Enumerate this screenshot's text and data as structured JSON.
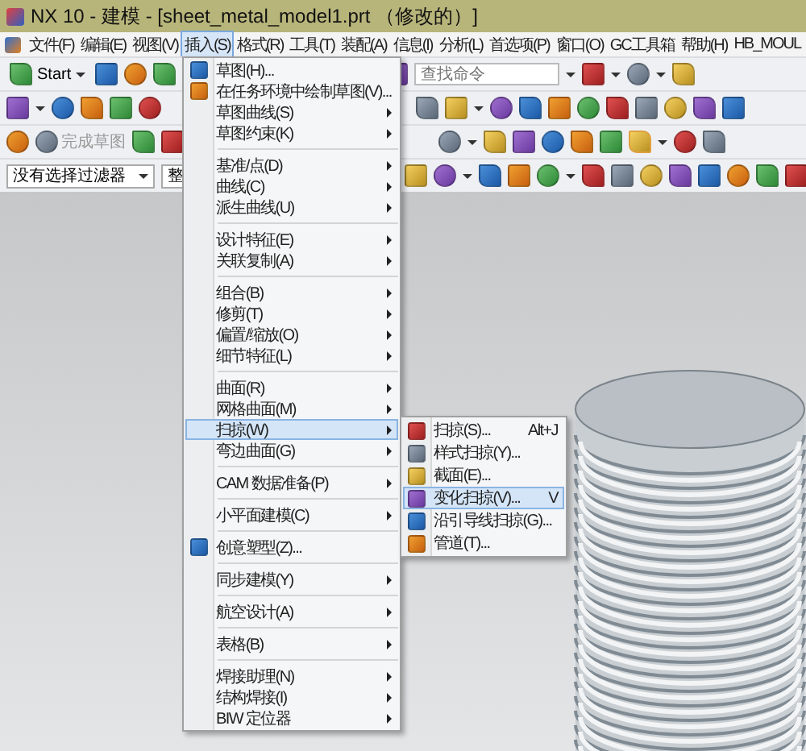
{
  "window": {
    "title": "NX 10 - 建模 - [sheet_metal_model1.prt （修改的）]"
  },
  "menubar": [
    {
      "label": "文件(F)",
      "selected": false
    },
    {
      "label": "编辑(E)",
      "selected": false
    },
    {
      "label": "视图(V)",
      "selected": false
    },
    {
      "label": "插入(S)",
      "selected": true
    },
    {
      "label": "格式(R)",
      "selected": false
    },
    {
      "label": "工具(T)",
      "selected": false
    },
    {
      "label": "装配(A)",
      "selected": false
    },
    {
      "label": "信息(I)",
      "selected": false
    },
    {
      "label": "分析(L)",
      "selected": false
    },
    {
      "label": "首选项(P)",
      "selected": false
    },
    {
      "label": "窗口(O)",
      "selected": false
    },
    {
      "label": "GC工具箱",
      "selected": false
    },
    {
      "label": "帮助(H)",
      "selected": false
    },
    {
      "label": "HB_MOUL",
      "selected": false
    }
  ],
  "toolbar": {
    "start_button": "Start",
    "search": {
      "placeholder": "查找命令"
    },
    "finish_sketch": {
      "label": "完成草图",
      "disabled": true
    },
    "filter_dropdown": {
      "value": "没有选择过滤器"
    },
    "scope_dropdown": {
      "value": "整"
    }
  },
  "insert_menu": {
    "groups": [
      [
        {
          "label": "草图(H)...",
          "kind": "command",
          "selected": false
        },
        {
          "label": "在任务环境中绘制草图(V)...",
          "kind": "command",
          "selected": false
        },
        {
          "label": "草图曲线(S)",
          "kind": "submenu",
          "selected": false
        },
        {
          "label": "草图约束(K)",
          "kind": "submenu",
          "selected": false
        }
      ],
      [
        {
          "label": "基准/点(D)",
          "kind": "submenu",
          "selected": false
        },
        {
          "label": "曲线(C)",
          "kind": "submenu",
          "selected": false
        },
        {
          "label": "派生曲线(U)",
          "kind": "submenu",
          "selected": false
        }
      ],
      [
        {
          "label": "设计特征(E)",
          "kind": "submenu",
          "selected": false
        },
        {
          "label": "关联复制(A)",
          "kind": "submenu",
          "selected": false
        }
      ],
      [
        {
          "label": "组合(B)",
          "kind": "submenu",
          "selected": false
        },
        {
          "label": "修剪(T)",
          "kind": "submenu",
          "selected": false
        },
        {
          "label": "偏置/缩放(O)",
          "kind": "submenu",
          "selected": false
        },
        {
          "label": "细节特征(L)",
          "kind": "submenu",
          "selected": false
        }
      ],
      [
        {
          "label": "曲面(R)",
          "kind": "submenu",
          "selected": false
        },
        {
          "label": "网格曲面(M)",
          "kind": "submenu",
          "selected": false
        },
        {
          "label": "扫掠(W)",
          "kind": "submenu",
          "selected": true
        },
        {
          "label": "弯边曲面(G)",
          "kind": "submenu",
          "selected": false
        }
      ],
      [
        {
          "label": "CAM 数据准备(P)",
          "kind": "submenu",
          "selected": false
        }
      ],
      [
        {
          "label": "小平面建模(C)",
          "kind": "submenu",
          "selected": false
        }
      ],
      [
        {
          "label": "创意塑型(Z)...",
          "kind": "command",
          "selected": false
        }
      ],
      [
        {
          "label": "同步建模(Y)",
          "kind": "submenu",
          "selected": false
        }
      ],
      [
        {
          "label": "航空设计(A)",
          "kind": "submenu",
          "selected": false
        }
      ],
      [
        {
          "label": "表格(B)",
          "kind": "submenu",
          "selected": false
        }
      ],
      [
        {
          "label": "焊接助理(N)",
          "kind": "submenu",
          "selected": false
        },
        {
          "label": "结构焊接(I)",
          "kind": "submenu",
          "selected": false
        },
        {
          "label": "BIW 定位器",
          "kind": "submenu",
          "selected": false
        }
      ]
    ]
  },
  "sweep_submenu": {
    "items": [
      {
        "label": "扫掠(S)...",
        "shortcut": "Alt+J",
        "selected": false
      },
      {
        "label": "样式扫掠(Y)...",
        "selected": false
      },
      {
        "label": "截面(E)...",
        "selected": false
      },
      {
        "label": "变化扫掠(V)...",
        "shortcut": "V",
        "selected": true
      },
      {
        "label": "沿引导线扫掠(G)...",
        "selected": false
      },
      {
        "label": "管道(T)...",
        "selected": false
      }
    ]
  }
}
